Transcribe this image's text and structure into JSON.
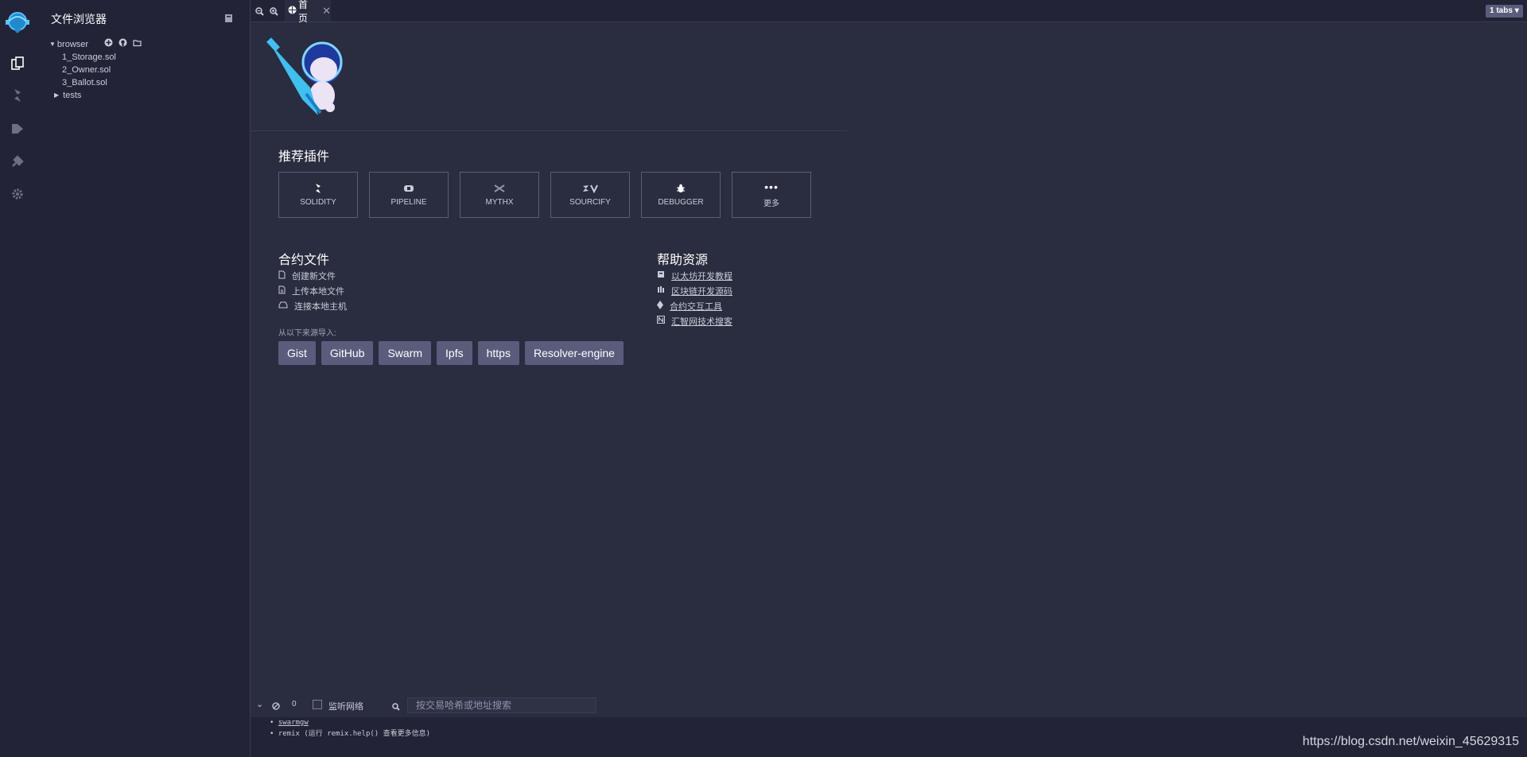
{
  "sidebar": {
    "title": "文件浏览器",
    "workspace": "browser",
    "files": [
      "1_Storage.sol",
      "2_Owner.sol",
      "3_Ballot.sol"
    ],
    "folders": [
      "tests"
    ]
  },
  "tabs": {
    "home_label": "首页",
    "count_label": "1 tabs"
  },
  "featured": {
    "title": "推荐插件",
    "plugins": [
      "SOLIDITY",
      "PIPELINE",
      "MYTHX",
      "SOURCIFY",
      "DEBUGGER",
      "更多"
    ]
  },
  "files_section": {
    "title": "合约文件",
    "items": [
      "创建新文件",
      "上传本地文件",
      "连接本地主机"
    ]
  },
  "help": {
    "title": "帮助资源",
    "items": [
      "以太坊开发教程",
      "区块链开发源码",
      "合约交互工具",
      "汇智网技术搜客"
    ]
  },
  "import": {
    "label": "从以下来源导入:",
    "buttons": [
      "Gist",
      "GitHub",
      "Swarm",
      "Ipfs",
      "https",
      "Resolver-engine"
    ]
  },
  "terminal": {
    "pending_count": "0",
    "listen_label": "监听网络",
    "search_placeholder": "按交易哈希或地址搜索",
    "lines": [
      "swarmgw",
      "remix (运行 remix.help() 查看更多信息)"
    ]
  },
  "watermark": "https://blog.csdn.net/weixin_45629315",
  "colors": {
    "background": "#2a2c3f",
    "panel": "#222336",
    "button": "#595d7b",
    "accent": "#2ea8e0"
  }
}
